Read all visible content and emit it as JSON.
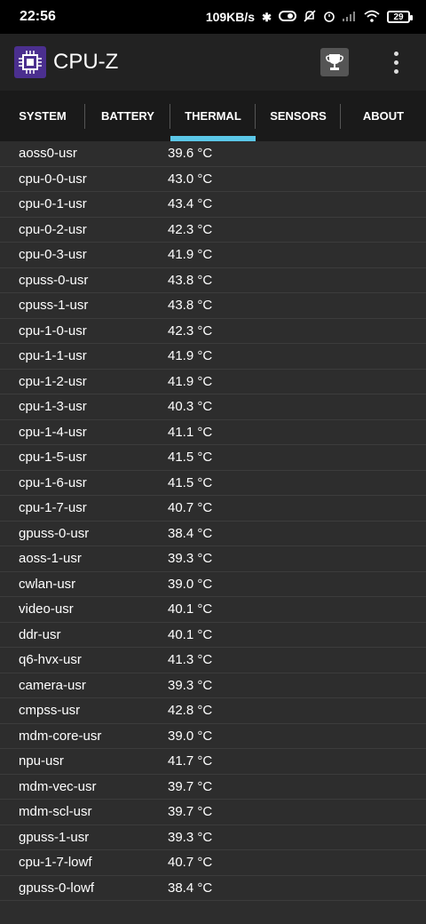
{
  "status_bar": {
    "time": "22:56",
    "net_speed": "109KB/s",
    "battery": "29",
    "icons": [
      "bluetooth-icon",
      "toggle-icon",
      "mute-icon",
      "alarm-icon",
      "signal-icon",
      "wifi-icon",
      "battery-icon"
    ]
  },
  "app": {
    "title": "CPU-Z",
    "logo_icon": "cpu-chip-icon",
    "trophy_icon": "trophy-icon",
    "menu_icon": "overflow-menu-icon",
    "accent_color": "#5bc7e8",
    "logo_color": "#4b2f8f"
  },
  "tabs": [
    {
      "label": "SYSTEM",
      "active": false
    },
    {
      "label": "BATTERY",
      "active": false
    },
    {
      "label": "THERMAL",
      "active": true
    },
    {
      "label": "SENSORS",
      "active": false
    },
    {
      "label": "ABOUT",
      "active": false
    }
  ],
  "thermal": [
    {
      "name": "aoss0-usr",
      "value": "39.6 °C"
    },
    {
      "name": "cpu-0-0-usr",
      "value": "43.0 °C"
    },
    {
      "name": "cpu-0-1-usr",
      "value": "43.4 °C"
    },
    {
      "name": "cpu-0-2-usr",
      "value": "42.3 °C"
    },
    {
      "name": "cpu-0-3-usr",
      "value": "41.9 °C"
    },
    {
      "name": "cpuss-0-usr",
      "value": "43.8 °C"
    },
    {
      "name": "cpuss-1-usr",
      "value": "43.8 °C"
    },
    {
      "name": "cpu-1-0-usr",
      "value": "42.3 °C"
    },
    {
      "name": "cpu-1-1-usr",
      "value": "41.9 °C"
    },
    {
      "name": "cpu-1-2-usr",
      "value": "41.9 °C"
    },
    {
      "name": "cpu-1-3-usr",
      "value": "40.3 °C"
    },
    {
      "name": "cpu-1-4-usr",
      "value": "41.1 °C"
    },
    {
      "name": "cpu-1-5-usr",
      "value": "41.5 °C"
    },
    {
      "name": "cpu-1-6-usr",
      "value": "41.5 °C"
    },
    {
      "name": "cpu-1-7-usr",
      "value": "40.7 °C"
    },
    {
      "name": "gpuss-0-usr",
      "value": "38.4 °C"
    },
    {
      "name": "aoss-1-usr",
      "value": "39.3 °C"
    },
    {
      "name": "cwlan-usr",
      "value": "39.0 °C"
    },
    {
      "name": "video-usr",
      "value": "40.1 °C"
    },
    {
      "name": "ddr-usr",
      "value": "40.1 °C"
    },
    {
      "name": "q6-hvx-usr",
      "value": "41.3 °C"
    },
    {
      "name": "camera-usr",
      "value": "39.3 °C"
    },
    {
      "name": "cmpss-usr",
      "value": "42.8 °C"
    },
    {
      "name": "mdm-core-usr",
      "value": "39.0 °C"
    },
    {
      "name": "npu-usr",
      "value": "41.7 °C"
    },
    {
      "name": "mdm-vec-usr",
      "value": "39.7 °C"
    },
    {
      "name": "mdm-scl-usr",
      "value": "39.7 °C"
    },
    {
      "name": "gpuss-1-usr",
      "value": "39.3 °C"
    },
    {
      "name": "cpu-1-7-lowf",
      "value": "40.7 °C"
    },
    {
      "name": "gpuss-0-lowf",
      "value": "38.4 °C"
    }
  ]
}
